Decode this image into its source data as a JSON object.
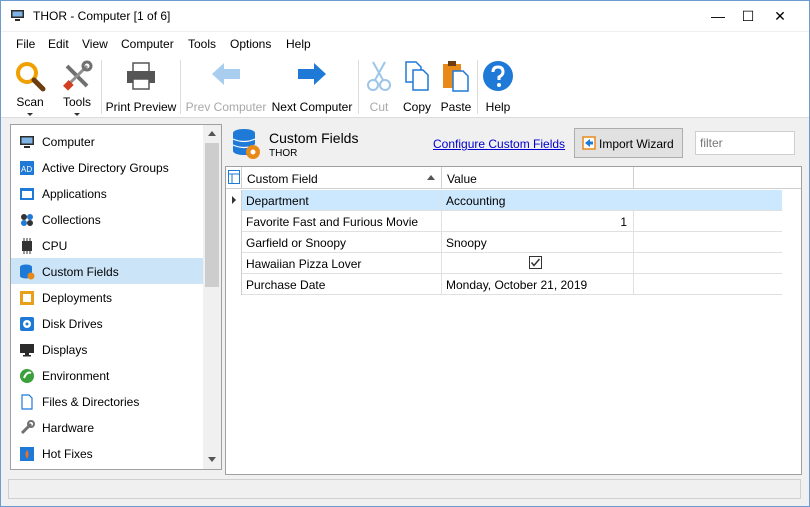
{
  "window": {
    "title": "THOR - Computer [1 of 6]",
    "minimize_glyph": "—",
    "maximize_glyph": "☐",
    "close_glyph": "✕"
  },
  "menu": [
    "File",
    "Edit",
    "View",
    "Computer",
    "Tools",
    "Options",
    "Help"
  ],
  "toolbar": {
    "scan": "Scan",
    "tools": "Tools",
    "print_preview": "Print Preview",
    "prev_computer": "Prev Computer",
    "next_computer": "Next Computer",
    "cut": "Cut",
    "copy": "Copy",
    "paste": "Paste",
    "help": "Help"
  },
  "nav": {
    "items": [
      {
        "label": "Computer",
        "icon": "computer-icon"
      },
      {
        "label": "Active Directory Groups",
        "icon": "ad-groups-icon"
      },
      {
        "label": "Applications",
        "icon": "applications-icon"
      },
      {
        "label": "Collections",
        "icon": "collections-icon"
      },
      {
        "label": "CPU",
        "icon": "cpu-icon"
      },
      {
        "label": "Custom Fields",
        "icon": "custom-fields-icon"
      },
      {
        "label": "Deployments",
        "icon": "deployments-icon"
      },
      {
        "label": "Disk Drives",
        "icon": "disk-drives-icon"
      },
      {
        "label": "Displays",
        "icon": "displays-icon"
      },
      {
        "label": "Environment",
        "icon": "environment-icon"
      },
      {
        "label": "Files & Directories",
        "icon": "files-icon"
      },
      {
        "label": "Hardware",
        "icon": "hardware-icon"
      },
      {
        "label": "Hot Fixes",
        "icon": "hot-fixes-icon"
      }
    ],
    "selected": "Custom Fields"
  },
  "panel": {
    "title": "Custom Fields",
    "subtitle": "THOR",
    "configure_link": "Configure Custom Fields",
    "import_button": "Import Wizard",
    "filter_placeholder": "filter"
  },
  "grid": {
    "columns": [
      "Custom Field",
      "Value"
    ],
    "rows": [
      {
        "field": "Department",
        "value": "Accounting",
        "selected": true
      },
      {
        "field": "Favorite Fast and Furious Movie",
        "value": "1",
        "align": "right"
      },
      {
        "field": "Garfield or Snoopy",
        "value": "Snoopy"
      },
      {
        "field": "Hawaiian Pizza Lover",
        "value": "",
        "checkbox": true,
        "checked": true
      },
      {
        "field": "Purchase Date",
        "value": "Monday, October 21, 2019"
      }
    ]
  },
  "colors": {
    "accent_blue": "#1e7ad6",
    "selection": "#cce4f7",
    "link": "#0000cc"
  }
}
